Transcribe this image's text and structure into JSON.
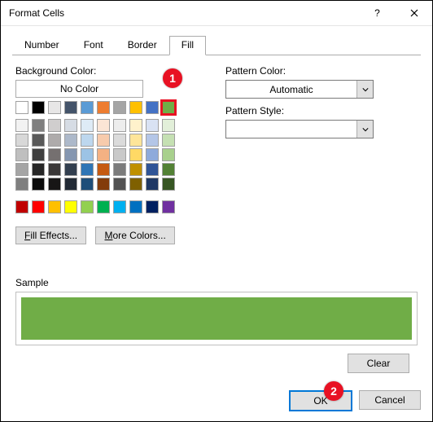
{
  "window": {
    "title": "Format Cells"
  },
  "tabs": {
    "number": "Number",
    "font": "Font",
    "border": "Border",
    "fill": "Fill"
  },
  "fill": {
    "bg_label": "Background Color:",
    "no_color": "No Color",
    "fill_effects_pre": "F",
    "fill_effects_rest": "ill Effects...",
    "more_colors_pre": "M",
    "more_colors_rest": "ore Colors...",
    "pattern_color": "Pattern Color:",
    "automatic": "Automatic",
    "pattern_style": "Pattern Style:",
    "selected_color": "#70ad47",
    "theme_tints": [
      [
        "#f2f2f2",
        "#7f7f7f",
        "#d0cece",
        "#d6dce4",
        "#deebf6",
        "#fbe5d5",
        "#ededed",
        "#fff2cc",
        "#d9e2f3",
        "#e2efd9"
      ],
      [
        "#d8d8d8",
        "#595959",
        "#aeabab",
        "#adb9ca",
        "#bdd7ee",
        "#f7cbac",
        "#dbdbdb",
        "#fee599",
        "#b4c6e7",
        "#c5e0b3"
      ],
      [
        "#bfbfbf",
        "#3f3f3f",
        "#757070",
        "#8496b0",
        "#9cc3e5",
        "#f4b183",
        "#c9c9c9",
        "#ffd965",
        "#8eaadb",
        "#a8d08d"
      ],
      [
        "#a5a5a5",
        "#262626",
        "#3a3838",
        "#323f4f",
        "#2e75b5",
        "#c55a11",
        "#7b7b7b",
        "#bf9000",
        "#2f5496",
        "#538135"
      ],
      [
        "#7f7f7f",
        "#0c0c0c",
        "#171616",
        "#222a35",
        "#1e4e79",
        "#833c0b",
        "#525252",
        "#7f6000",
        "#1f3864",
        "#375623"
      ]
    ]
  },
  "sample": {
    "label": "Sample"
  },
  "buttons": {
    "clear": "Clear",
    "ok": "OK",
    "cancel": "Cancel"
  },
  "markers": {
    "one": "1",
    "two": "2"
  }
}
